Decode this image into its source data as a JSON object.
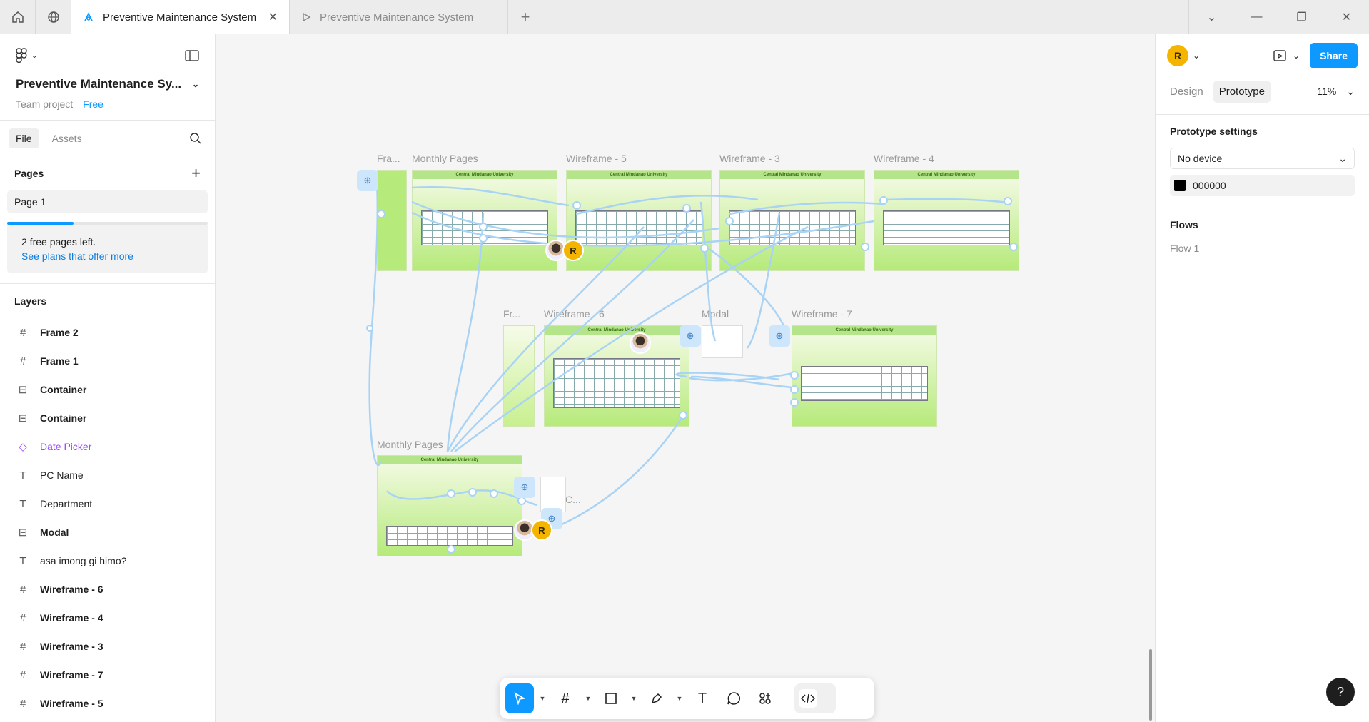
{
  "tabs": {
    "active": "Preventive Maintenance System",
    "inactive": "Preventive Maintenance System"
  },
  "left": {
    "project_title": "Preventive Maintenance Sy...",
    "team": "Team project",
    "plan": "Free",
    "file_tab": "File",
    "assets_tab": "Assets",
    "pages_header": "Pages",
    "page1": "Page 1",
    "free_pages": "2 free pages left.",
    "plans_link": "See plans that offer more",
    "pages_used_fraction": 0.33,
    "layers_header": "Layers",
    "layers": [
      {
        "label": "Frame 2",
        "icon": "frame-icon"
      },
      {
        "label": "Frame 1",
        "icon": "frame-icon"
      },
      {
        "label": "Container",
        "icon": "container-icon"
      },
      {
        "label": "Container",
        "icon": "container-icon"
      },
      {
        "label": "Date Picker",
        "icon": "component-icon"
      },
      {
        "label": "PC Name",
        "icon": "text-icon"
      },
      {
        "label": "Department",
        "icon": "text-icon"
      },
      {
        "label": "Modal",
        "icon": "container-icon"
      },
      {
        "label": "asa imong gi himo?",
        "icon": "text-icon"
      },
      {
        "label": "Wireframe - 6",
        "icon": "frame-icon"
      },
      {
        "label": "Wireframe - 4",
        "icon": "frame-icon"
      },
      {
        "label": "Wireframe - 3",
        "icon": "frame-icon"
      },
      {
        "label": "Wireframe - 7",
        "icon": "frame-icon"
      },
      {
        "label": "Wireframe - 5",
        "icon": "frame-icon"
      }
    ]
  },
  "canvas": {
    "labels": {
      "fra": "Fra...",
      "monthly1": "Monthly Pages",
      "wf5": "Wireframe - 5",
      "wf3": "Wireframe - 3",
      "wf4": "Wireframe - 4",
      "fr2": "Fr...",
      "wf6": "Wireframe - 6",
      "modal": "Modal",
      "wf7": "Wireframe - 7",
      "monthly2": "Monthly Pages",
      "c": "C..."
    },
    "frame_header": "Central Mindanao University",
    "collaborator_initial": "R"
  },
  "right": {
    "avatar_initial": "R",
    "share": "Share",
    "design_tab": "Design",
    "prototype_tab": "Prototype",
    "zoom": "11%",
    "proto_settings": "Prototype settings",
    "device": "No device",
    "bg_color": "000000",
    "flows": "Flows",
    "flow1": "Flow 1"
  },
  "colors": {
    "accent": "#0d99ff",
    "frame_green": "#b6ea7a",
    "connector": "#a9d3f5"
  }
}
